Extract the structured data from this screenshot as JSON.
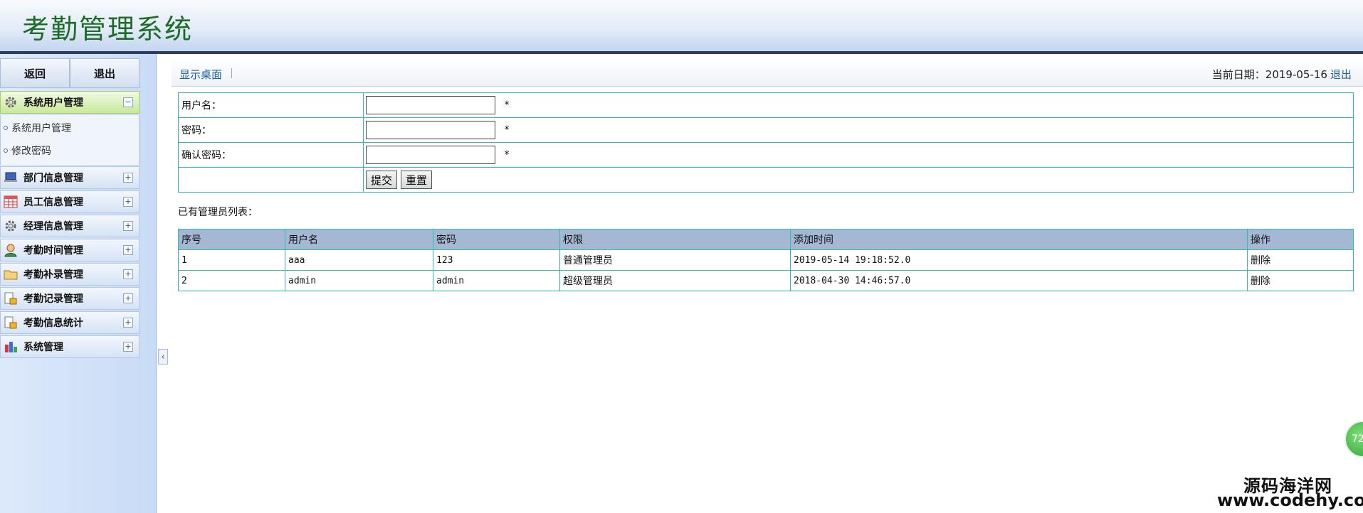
{
  "header": {
    "title": "考勤管理系统"
  },
  "sidebar": {
    "top_buttons": {
      "back": "返回",
      "exit": "退出"
    },
    "menus": [
      {
        "label": "系统用户管理",
        "icon": "gear-icon",
        "toggle": "−",
        "expanded": true
      },
      {
        "label": "部门信息管理",
        "icon": "laptop-icon",
        "toggle": "+"
      },
      {
        "label": "员工信息管理",
        "icon": "table-icon",
        "toggle": "+"
      },
      {
        "label": "经理信息管理",
        "icon": "gear-icon",
        "toggle": "+"
      },
      {
        "label": "考勤时间管理",
        "icon": "person-icon",
        "toggle": "+"
      },
      {
        "label": "考勤补录管理",
        "icon": "folder-icon",
        "toggle": "+"
      },
      {
        "label": "考勤记录管理",
        "icon": "document-lock-icon",
        "toggle": "+"
      },
      {
        "label": "考勤信息统计",
        "icon": "document-lock-icon",
        "toggle": "+"
      },
      {
        "label": "系统管理",
        "icon": "bar-chart-icon",
        "toggle": "+"
      }
    ],
    "submenu": [
      "系统用户管理",
      "修改密码"
    ],
    "collapse_glyph": "‹"
  },
  "toolbar": {
    "show_desktop": "显示桌面",
    "date_label": "当前日期：",
    "date_value": "2019-05-16",
    "logout": "退出"
  },
  "form": {
    "username_label": "用户名：",
    "password_label": "密码：",
    "confirm_label": "确认密码：",
    "username_value": "",
    "password_value": "",
    "confirm_value": "",
    "required_mark": "*",
    "submit_label": "提交",
    "reset_label": "重置"
  },
  "list": {
    "caption": "已有管理员列表：",
    "columns": [
      "序号",
      "用户名",
      "密码",
      "权限",
      "添加时间",
      "操作"
    ],
    "rows": [
      {
        "no": "1",
        "username": "aaa",
        "password": "123",
        "role": "普通管理员",
        "added": "2019-05-14 19:18:52.0",
        "action": "删除"
      },
      {
        "no": "2",
        "username": "admin",
        "password": "admin",
        "role": "超级管理员",
        "added": "2018-04-30 14:46:57.0",
        "action": "删除"
      }
    ]
  },
  "watermark": {
    "badge": "72",
    "site_name": "源码海洋网",
    "site_url": "www.codehy.com"
  },
  "colors": {
    "title_green": "#1d6d28",
    "table_border": "#34b8b8",
    "table_header": "#a5b8d3",
    "link_blue": "#1f5fa6",
    "active_menu": "#c8e89a"
  }
}
